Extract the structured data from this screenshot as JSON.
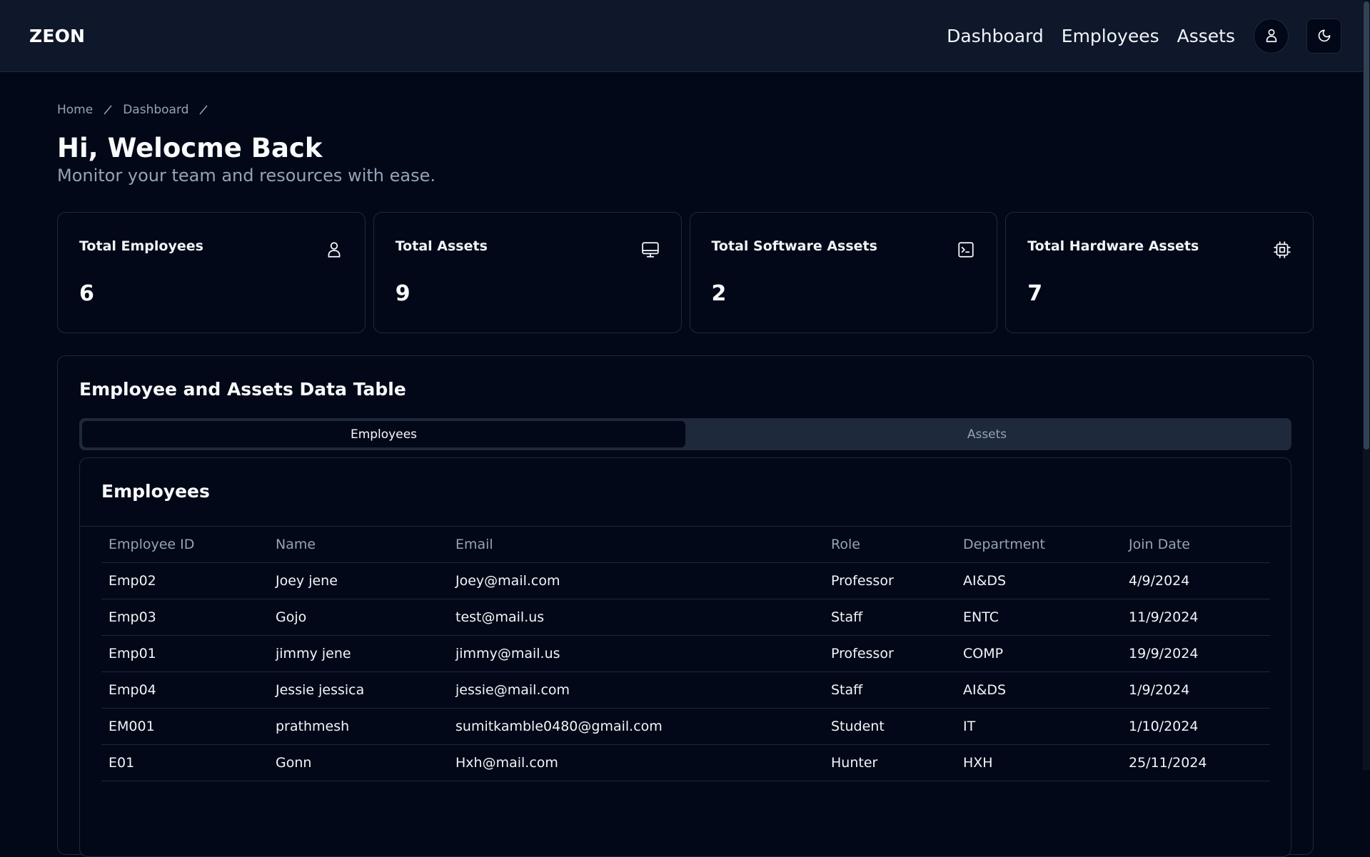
{
  "app": {
    "logo": "ZEON"
  },
  "nav": {
    "links": [
      "Dashboard",
      "Employees",
      "Assets"
    ]
  },
  "breadcrumb": [
    "Home",
    "Dashboard"
  ],
  "header": {
    "title": "Hi, Welocme Back",
    "subtitle": "Monitor your team and resources with ease."
  },
  "stats": [
    {
      "label": "Total Employees",
      "value": "6",
      "icon": "user-icon"
    },
    {
      "label": "Total Assets",
      "value": "9",
      "icon": "monitor-icon"
    },
    {
      "label": "Total Software Assets",
      "value": "2",
      "icon": "terminal-icon"
    },
    {
      "label": "Total Hardware Assets",
      "value": "7",
      "icon": "cpu-icon"
    }
  ],
  "table_section": {
    "title": "Employee and Assets Data Table",
    "tabs": [
      "Employees",
      "Assets"
    ],
    "active_tab": "Employees",
    "inner_title": "Employees",
    "columns": [
      "Employee ID",
      "Name",
      "Email",
      "Role",
      "Department",
      "Join Date"
    ],
    "rows": [
      [
        "Emp02",
        "Joey jene",
        "Joey@mail.com",
        "Professor",
        "AI&DS",
        "4/9/2024"
      ],
      [
        "Emp03",
        "Gojo",
        "test@mail.us",
        "Staff",
        "ENTC",
        "11/9/2024"
      ],
      [
        "Emp01",
        "jimmy jene",
        "jimmy@mail.us",
        "Professor",
        "COMP",
        "19/9/2024"
      ],
      [
        "Emp04",
        "Jessie jessica",
        "jessie@mail.com",
        "Staff",
        "AI&DS",
        "1/9/2024"
      ],
      [
        "EM001",
        "prathmesh",
        "sumitkamble0480@gmail.com",
        "Student",
        "IT",
        "1/10/2024"
      ],
      [
        "E01",
        "Gonn",
        "Hxh@mail.com",
        "Hunter",
        "HXH",
        "25/11/2024"
      ]
    ]
  },
  "colors": {
    "background": "#020817",
    "navbar": "#0f172a",
    "border": "#1e293b",
    "muted_text": "#94a3b8"
  }
}
